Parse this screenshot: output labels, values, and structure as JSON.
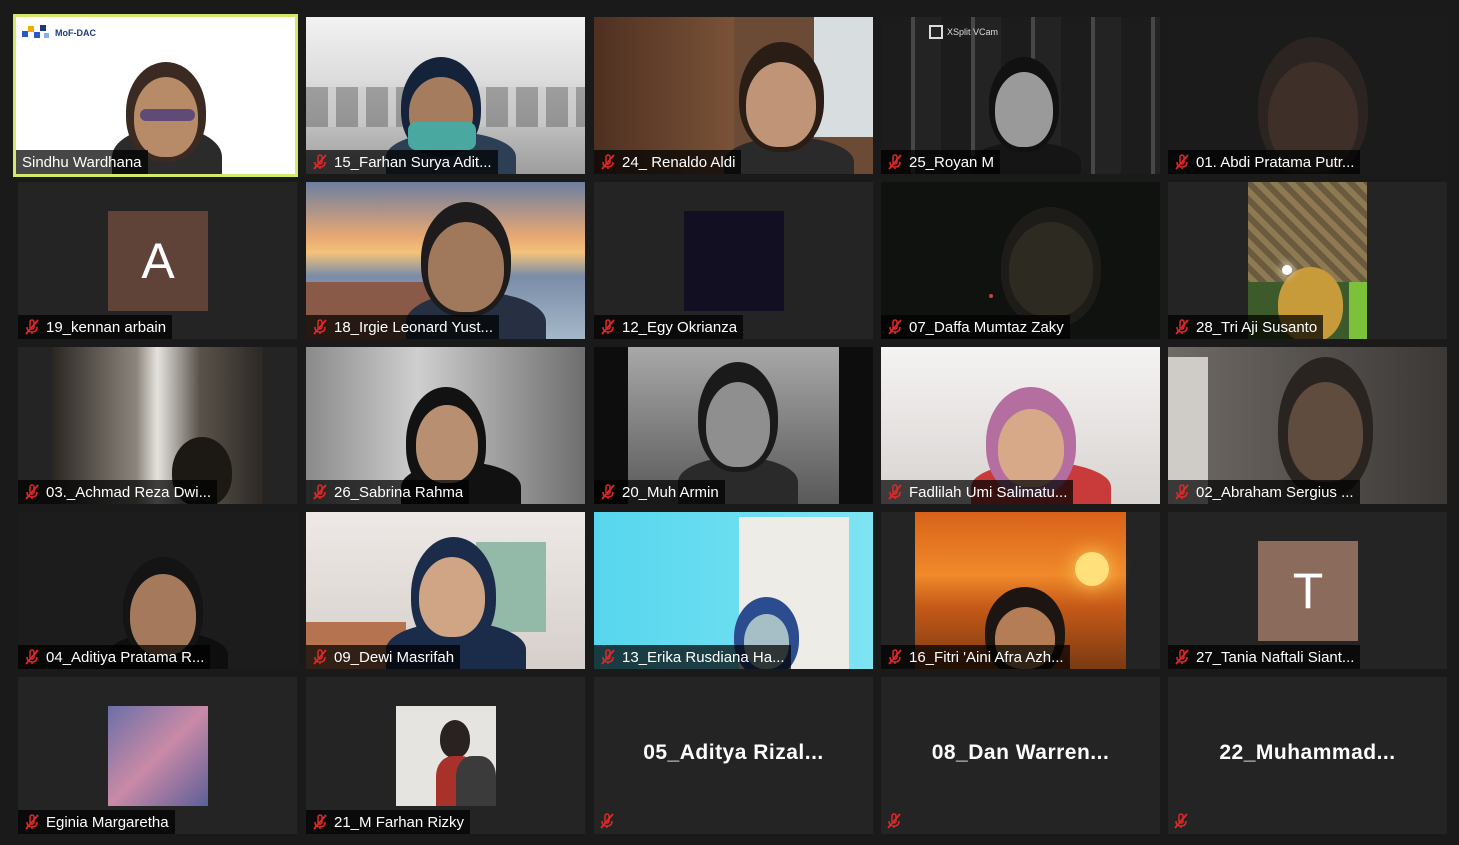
{
  "participants": [
    {
      "name": "Sindhu Wardhana",
      "active": true,
      "muted": false,
      "logo_text": "MoF-DAC"
    },
    {
      "name": "15_Farhan Surya Adit..."
    },
    {
      "name": "24_ Renaldo Aldi"
    },
    {
      "name": "25_Royan M",
      "overlay_text": "XSplit VCam"
    },
    {
      "name": "01. Abdi Pratama Putr..."
    },
    {
      "name": "19_kennan arbain",
      "avatar_letter": "A"
    },
    {
      "name": "18_Irgie Leonard Yust..."
    },
    {
      "name": "12_Egy Okrianza"
    },
    {
      "name": "07_Daffa Mumtaz Zaky"
    },
    {
      "name": "28_Tri Aji Susanto"
    },
    {
      "name": "03._Achmad Reza Dwi..."
    },
    {
      "name": "26_Sabrina Rahma"
    },
    {
      "name": "20_Muh Armin"
    },
    {
      "name": "Fadlilah Umi Salimatu..."
    },
    {
      "name": "02_Abraham Sergius ..."
    },
    {
      "name": "04_Aditiya Pratama R..."
    },
    {
      "name": "09_Dewi Masrifah"
    },
    {
      "name": "13_Erika Rusdiana Ha..."
    },
    {
      "name": "16_Fitri 'Aini Afra Azh..."
    },
    {
      "name": "27_Tania Naftali Siant...",
      "avatar_letter": "T"
    },
    {
      "name": "Eginia Margaretha"
    },
    {
      "name": "21_M Farhan Rizky"
    },
    {
      "name": "05_Aditya  Rizal...",
      "video_off": true
    },
    {
      "name": "08_Dan  Warren...",
      "video_off": true
    },
    {
      "name": "22_Muhammad...",
      "video_off": true
    }
  ],
  "colors": {
    "active_border": "#d4e96a",
    "muted_icon": "#e02828",
    "background": "#1a1a1a",
    "tile": "#242424"
  },
  "icons": {
    "muted": "mic-muted-icon"
  }
}
